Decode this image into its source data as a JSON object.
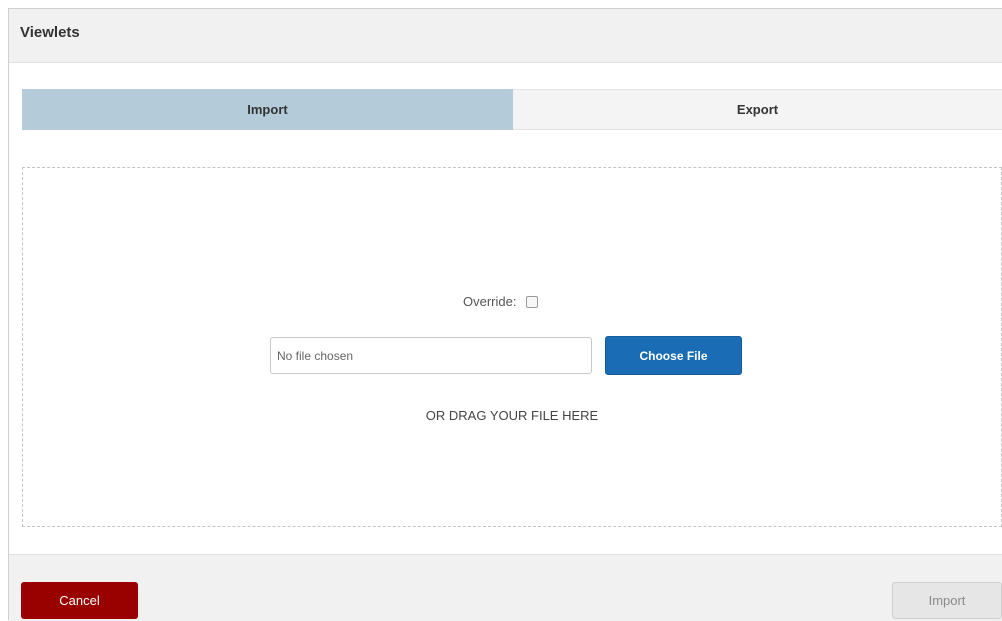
{
  "dialog": {
    "title": "Viewlets"
  },
  "tabs": [
    {
      "label": "Import",
      "active": true
    },
    {
      "label": "Export",
      "active": false
    }
  ],
  "import_panel": {
    "override_label": "Override:",
    "override_checked": false,
    "file_input": {
      "value": "No file chosen"
    },
    "choose_file_label": "Choose File",
    "drag_hint": "OR DRAG YOUR FILE HERE"
  },
  "footer": {
    "cancel_label": "Cancel",
    "import_label": "Import",
    "import_enabled": false
  },
  "colors": {
    "active_tab": "#b4cbda",
    "primary_button": "#1a6cb5",
    "cancel_button": "#990000"
  }
}
